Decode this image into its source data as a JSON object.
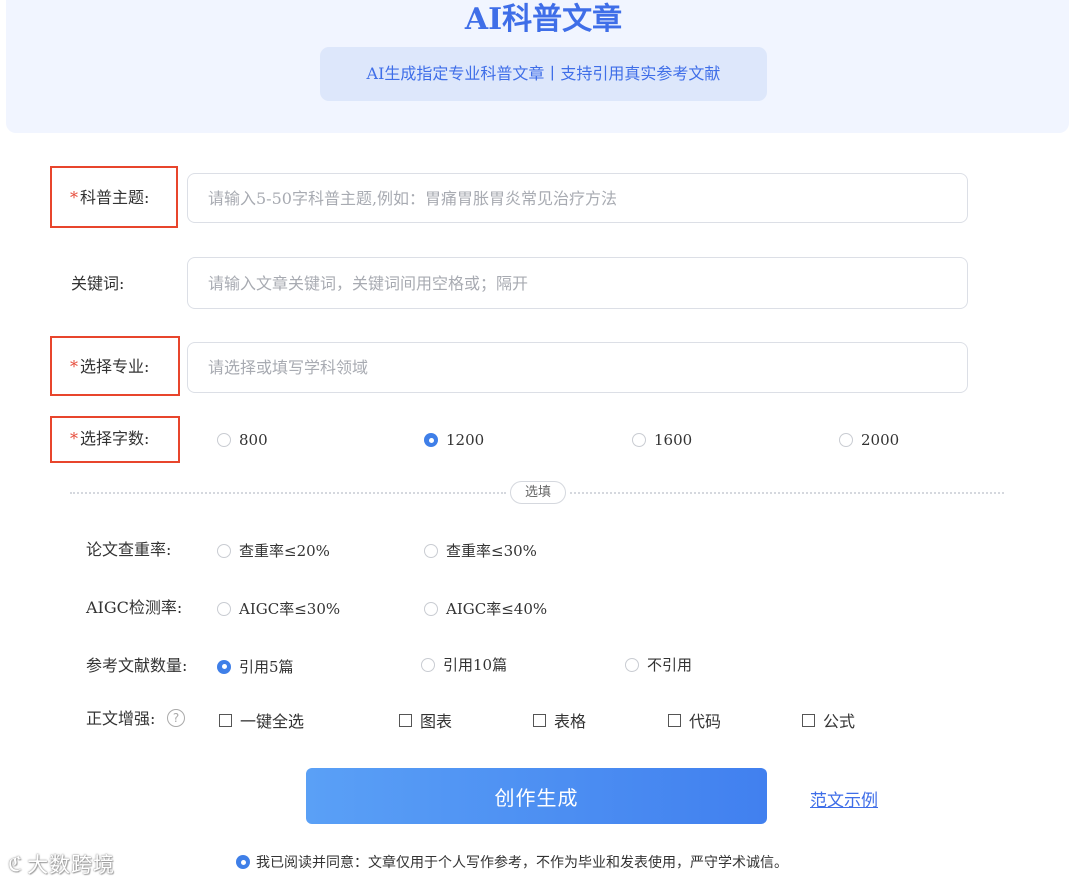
{
  "header": {
    "title": "AI科普文章",
    "subtitle": "AI生成指定专业科普文章丨支持引用真实参考文献"
  },
  "form": {
    "topic": {
      "label": "科普主题:",
      "required": true,
      "placeholder": "请输入5-50字科普主题,例如：胃痛胃胀胃炎常见治疗方法",
      "value": ""
    },
    "keywords": {
      "label": "关键词:",
      "required": false,
      "placeholder": "请输入文章关键词，关键词间用空格或；隔开",
      "value": ""
    },
    "major": {
      "label": "选择专业:",
      "required": true,
      "placeholder": "请选择或填写学科领域",
      "value": ""
    },
    "word_count": {
      "label": "选择字数:",
      "required": true,
      "options": [
        "800",
        "1200",
        "1600",
        "2000"
      ],
      "selected": "1200"
    }
  },
  "optional_divider": "选填",
  "optional": {
    "plagiarism": {
      "label": "论文查重率:",
      "options": [
        "查重率≤20%",
        "查重率≤30%"
      ],
      "selected": ""
    },
    "aigc": {
      "label": "AIGC检测率:",
      "options": [
        "AIGC率≤30%",
        "AIGC率≤40%"
      ],
      "selected": ""
    },
    "references": {
      "label": "参考文献数量:",
      "options": [
        "引用5篇",
        "引用10篇",
        "不引用"
      ],
      "selected": "引用5篇"
    },
    "enhance": {
      "label": "正文增强:",
      "help_icon": "question-circle-icon",
      "options": [
        "一键全选",
        "图表",
        "表格",
        "代码",
        "公式"
      ],
      "checked": []
    }
  },
  "actions": {
    "generate_label": "创作生成",
    "example_label": "范文示例"
  },
  "agreement": {
    "text": "我已阅读并同意：文章仅用于个人写作参考，不作为毕业和发表使用，严守学术诚信。",
    "checked": true
  },
  "watermark": {
    "text": "大数跨境",
    "logo": "logo-icon"
  },
  "colors": {
    "accent": "#3f6ee8",
    "required_star": "#e64b3a",
    "highlight_border": "#e8452c",
    "header_bg": "#f1f5ff"
  }
}
